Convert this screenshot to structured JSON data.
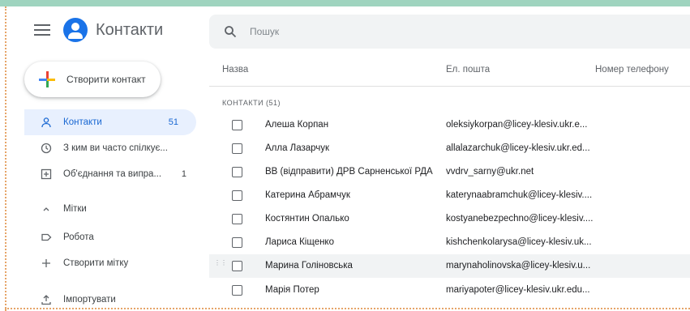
{
  "header": {
    "app_title": "Контакти",
    "search_placeholder": "Пошук"
  },
  "sidebar": {
    "create_label": "Створити контакт",
    "items": [
      {
        "label": "Контакти",
        "count": "51",
        "icon": "person-icon",
        "active": true
      },
      {
        "label": "З ким ви часто спілкує...",
        "count": "",
        "icon": "history-icon",
        "active": false
      },
      {
        "label": "Об'єднання та випра...",
        "count": "1",
        "icon": "merge-icon",
        "active": false
      },
      {
        "label": "Мітки",
        "count": "",
        "icon": "chevron-up-icon",
        "active": false
      },
      {
        "label": "Робота",
        "count": "",
        "icon": "label-icon",
        "active": false
      },
      {
        "label": "Створити мітку",
        "count": "",
        "icon": "add-icon",
        "active": false
      },
      {
        "label": "Імпортувати",
        "count": "",
        "icon": "import-icon",
        "active": false
      }
    ]
  },
  "table": {
    "columns": [
      "Назва",
      "Ел. пошта",
      "Номер телефону"
    ],
    "section_label": "КОНТАКТИ (51)",
    "rows": [
      {
        "name": "Алеша Корпан",
        "email": "oleksiykorpan@licey-klesiv.ukr.e..."
      },
      {
        "name": "Алла Лазарчук",
        "email": "allalazarchuk@licey-klesiv.ukr.ed..."
      },
      {
        "name": "ВВ (відправити) ДРВ Сарненської РДА",
        "email": "vvdrv_sarny@ukr.net"
      },
      {
        "name": "Катерина Абрамчук",
        "email": "katerynaabramchuk@licey-klesiv...."
      },
      {
        "name": "Костянтин Опалько",
        "email": "kostyanebezpechno@licey-klesiv...."
      },
      {
        "name": "Лариса Кіщенко",
        "email": "kishchenkolarysa@licey-klesiv.uk..."
      },
      {
        "name": "Марина Голіновська",
        "email": "marynaholinovska@licey-klesiv.u..."
      },
      {
        "name": "Марія Потер",
        "email": "mariyapoter@licey-klesiv.ukr.edu..."
      }
    ]
  },
  "colors": {
    "accent": "#1a73e8",
    "active_bg": "#e8f0fe",
    "frame_top": "#9fd4bf",
    "frame_dots": "#e6a468"
  }
}
